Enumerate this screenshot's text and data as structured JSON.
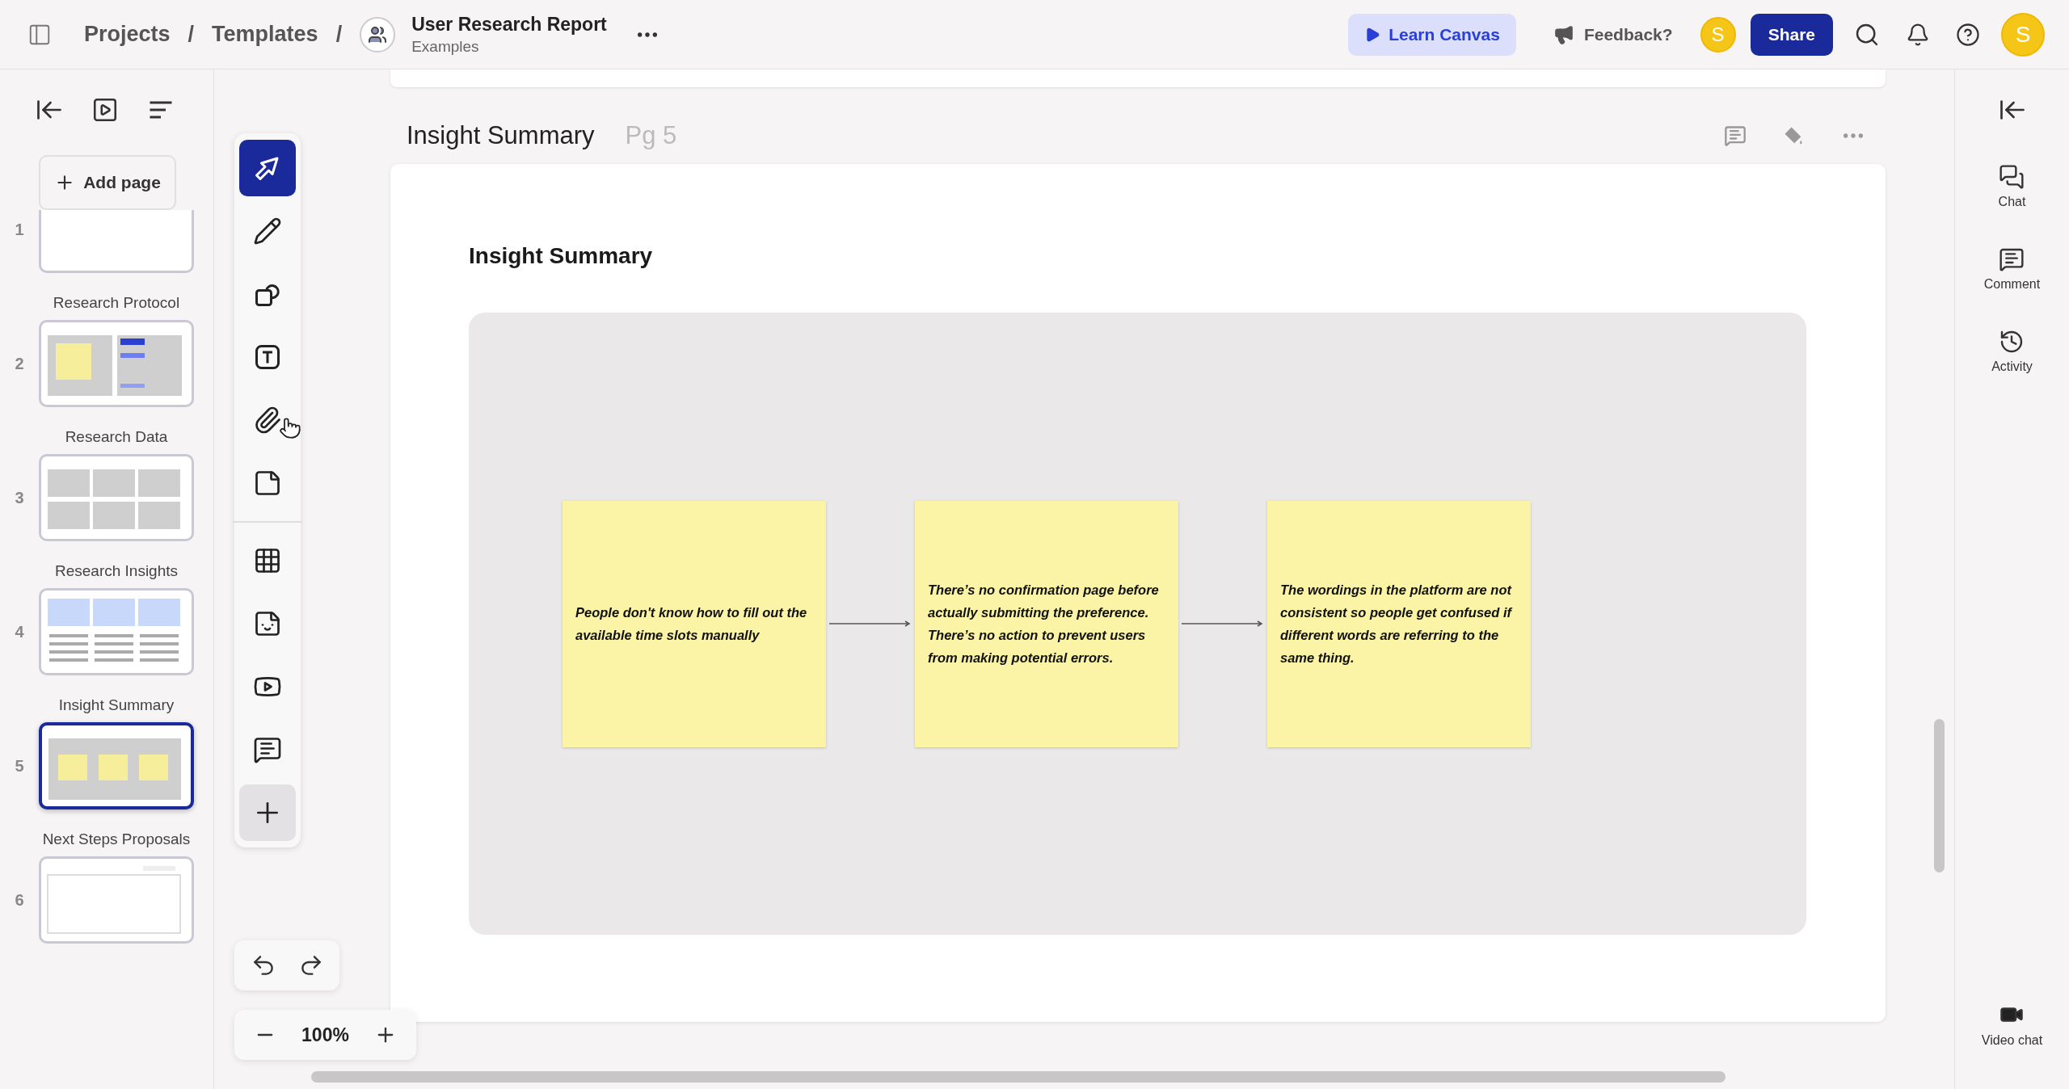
{
  "topbar": {
    "breadcrumbs": [
      {
        "label": "Projects",
        "separator": "/"
      },
      {
        "label": "Templates",
        "separator": "/"
      }
    ],
    "document": {
      "title": "User Research Report",
      "subtitle": "Examples"
    },
    "learn_button": "Learn Canvas",
    "feedback": "Feedback?",
    "collaborator_initial": "S",
    "share_button": "Share",
    "user_initial": "S"
  },
  "sidebar": {
    "add_page": "Add page",
    "pages": [
      {
        "number": "1",
        "kind": "blank",
        "selected": false
      },
      {
        "number": "2",
        "title": "Research Protocol",
        "kind": "protocol",
        "selected": false
      },
      {
        "number": "3",
        "title": "Research Data",
        "kind": "grid",
        "selected": false
      },
      {
        "number": "4",
        "title": "Research Insights",
        "kind": "insights",
        "selected": false
      },
      {
        "number": "5",
        "title": "Insight Summary",
        "kind": "stickies",
        "selected": true
      },
      {
        "number": "6",
        "title": "Next Steps Proposals",
        "kind": "proposals",
        "selected": false
      }
    ]
  },
  "tools": [
    {
      "kind": "select",
      "selected": true
    },
    {
      "kind": "pen",
      "selected": false
    },
    {
      "kind": "shapes",
      "selected": false
    },
    {
      "kind": "text",
      "selected": false
    },
    {
      "kind": "attach",
      "selected": false
    },
    {
      "kind": "note",
      "selected": false
    },
    {
      "kind": "divider"
    },
    {
      "kind": "table",
      "selected": false
    },
    {
      "kind": "sticker",
      "selected": false
    },
    {
      "kind": "video",
      "selected": false
    },
    {
      "kind": "comment",
      "selected": false
    },
    {
      "kind": "add",
      "selected": false
    }
  ],
  "zoom": "100%",
  "page": {
    "title": "Insight Summary",
    "page_label": "Pg 5",
    "heading": "Insight Summary",
    "notes": [
      {
        "text": "People don't know how to fill out the available time slots manually"
      },
      {
        "text": "There’s no confirmation page before actually submitting the preference. There’s no action to prevent users from making potential errors."
      },
      {
        "text": "The wordings in the platform are not consistent so people get confused if different words are referring to the same thing."
      }
    ]
  },
  "right_panel": {
    "items": [
      {
        "kind": "chat",
        "label": "Chat"
      },
      {
        "kind": "comment",
        "label": "Comment"
      },
      {
        "kind": "activity",
        "label": "Activity"
      }
    ],
    "video_chat": "Video chat"
  }
}
